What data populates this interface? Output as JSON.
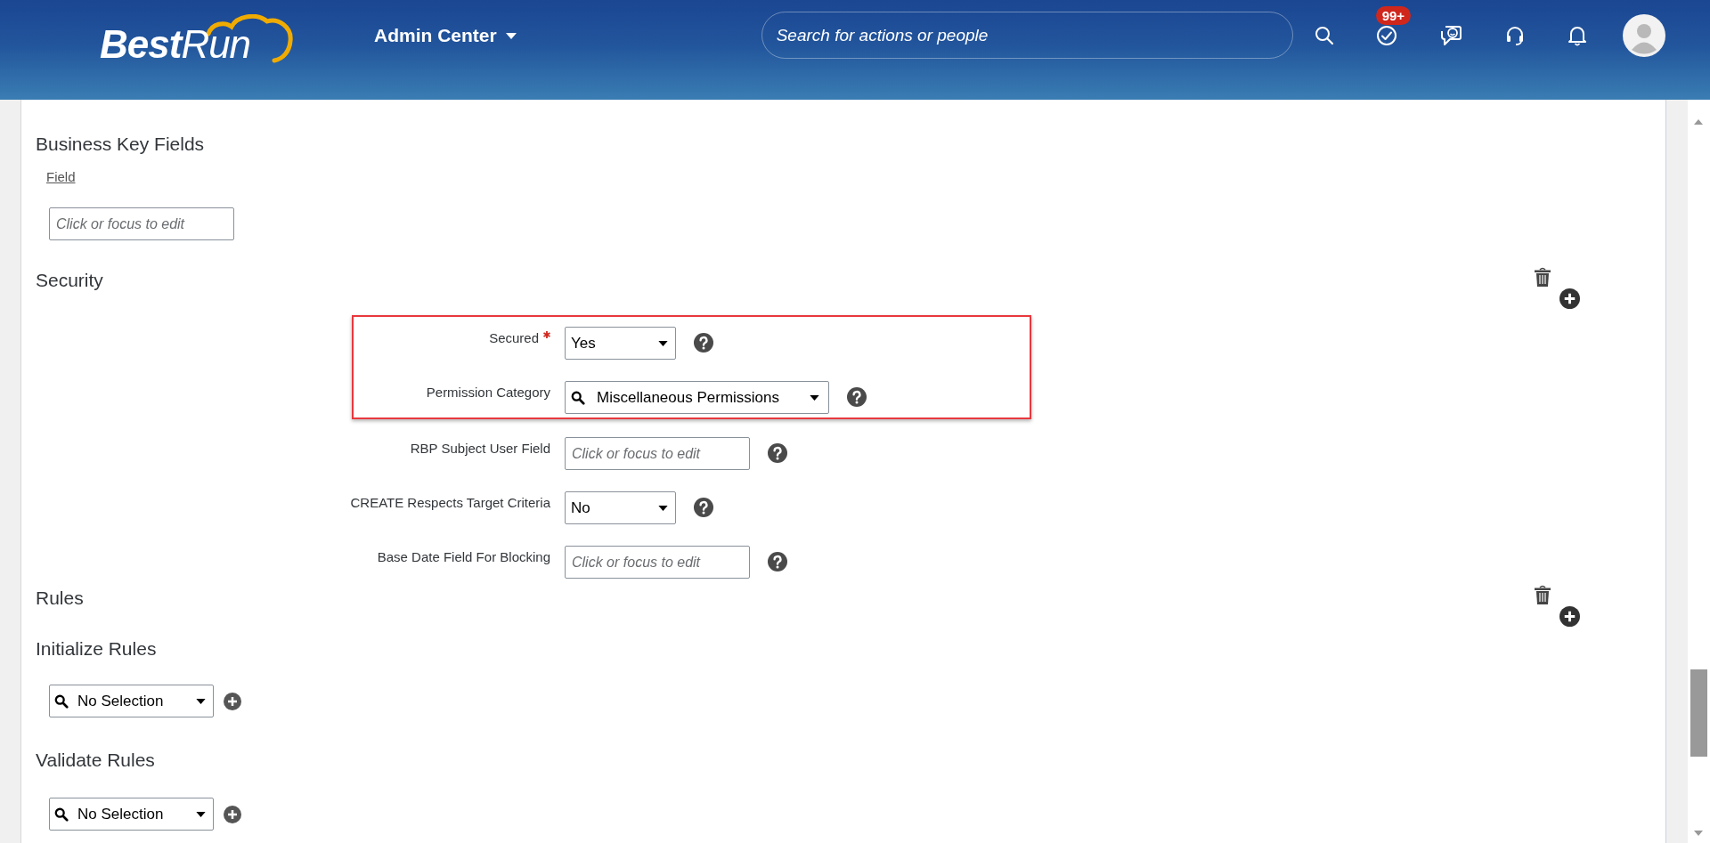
{
  "header": {
    "logo": "**Best**Run",
    "app_menu": "Admin Center",
    "search": {
      "placeholder": "Search for actions or people"
    },
    "todo_badge": "99+"
  },
  "sections": [
    {
      "kind": "key_fields",
      "title": "Business Key Fields",
      "removable": false,
      "column": "Field",
      "input": {
        "placeholder": "Click or focus to edit"
      }
    },
    {
      "kind": "form",
      "title": "Security",
      "removable": true,
      "groups": [
        {
          "highlighted": true,
          "fields": [
            {
              "kind": "select",
              "label": "Secured",
              "required": true,
              "value": "Yes"
            },
            {
              "kind": "lookup",
              "label": "Permission Category",
              "required": false,
              "value": "Miscellaneous Permissions"
            }
          ]
        },
        {
          "highlighted": false,
          "fields": [
            {
              "kind": "text",
              "label": "RBP Subject User Field",
              "required": false,
              "placeholder": "Click or focus to edit"
            },
            {
              "kind": "select",
              "label": "CREATE Respects Target Criteria",
              "required": false,
              "value": "No"
            },
            {
              "kind": "text",
              "label": "Base Date Field For Blocking",
              "required": false,
              "placeholder": "Click or focus to edit"
            }
          ]
        }
      ]
    },
    {
      "kind": "heading",
      "title": "Rules",
      "removable": true
    },
    {
      "kind": "rule_list",
      "title": "Initialize Rules",
      "value": "No Selection"
    },
    {
      "kind": "rule_list",
      "title": "Validate Rules",
      "value": "No Selection"
    }
  ]
}
